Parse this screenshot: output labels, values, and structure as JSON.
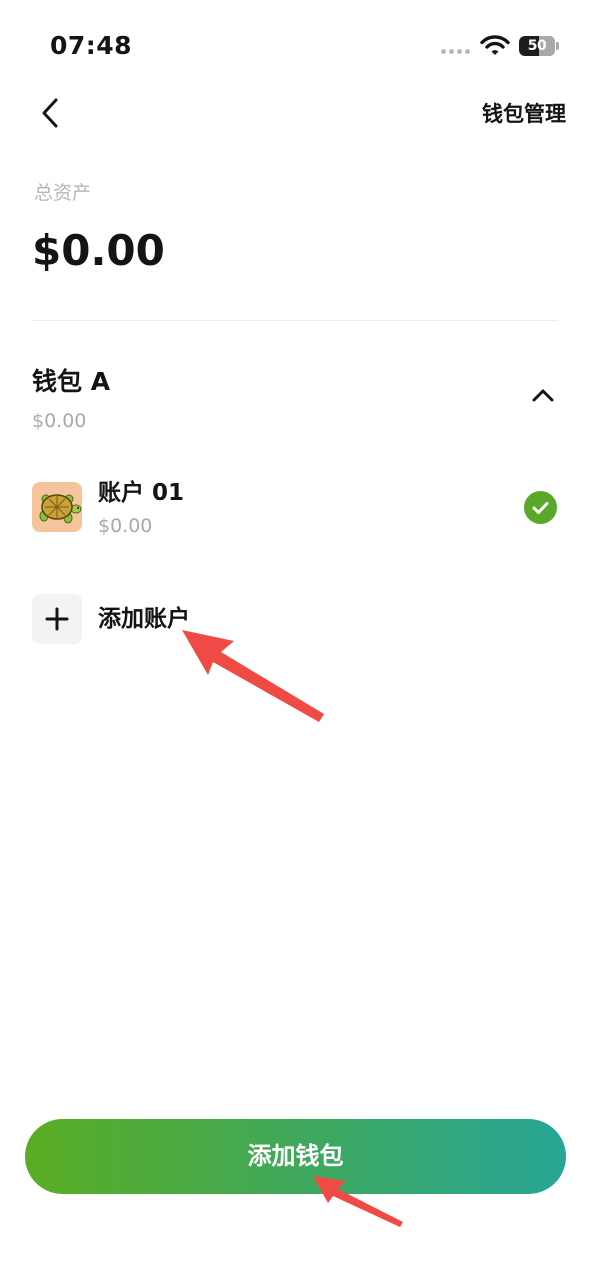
{
  "status_bar": {
    "time": "07:48",
    "battery": "50"
  },
  "header": {
    "manage_label": "钱包管理"
  },
  "summary": {
    "label": "总资产",
    "value": "$0.00"
  },
  "wallet": {
    "name": "钱包 A",
    "balance": "$0.00",
    "accounts": [
      {
        "name": "账户 01",
        "balance": "$0.00",
        "selected": true
      }
    ],
    "add_account_label": "添加账户"
  },
  "footer": {
    "add_wallet_label": "添加钱包"
  },
  "colors": {
    "accent_green": "#5aa82a",
    "button_gradient_start": "#5aad22",
    "button_gradient_end": "#27a696",
    "annotation_arrow": "#f04a44"
  }
}
